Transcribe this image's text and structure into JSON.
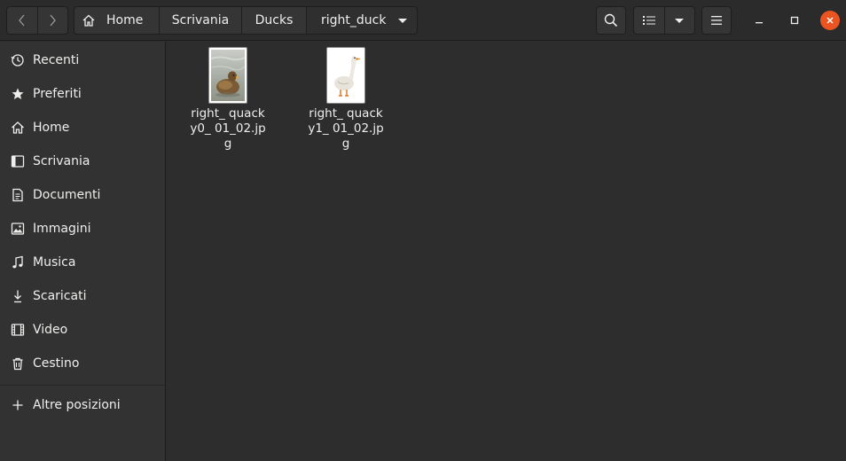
{
  "breadcrumb": [
    "Home",
    "Scrivania",
    "Ducks",
    "right_duck"
  ],
  "sidebar": {
    "items": [
      {
        "label": "Recenti",
        "icon": "clock-icon"
      },
      {
        "label": "Preferiti",
        "icon": "star-icon"
      },
      {
        "label": "Home",
        "icon": "home-icon"
      },
      {
        "label": "Scrivania",
        "icon": "desktop-icon"
      },
      {
        "label": "Documenti",
        "icon": "document-icon"
      },
      {
        "label": "Immagini",
        "icon": "image-icon"
      },
      {
        "label": "Musica",
        "icon": "music-icon"
      },
      {
        "label": "Scaricati",
        "icon": "download-icon"
      },
      {
        "label": "Video",
        "icon": "video-icon"
      },
      {
        "label": "Cestino",
        "icon": "trash-icon"
      }
    ],
    "other_locations": "Altre posizioni"
  },
  "files": [
    {
      "name": "right_ quacky0_ 01_02.jpg",
      "thumbnail": "brown-duck-on-water"
    },
    {
      "name": "right_ quacky1_ 01_02.jpg",
      "thumbnail": "white-goose"
    }
  ],
  "colors": {
    "accent": "#e95420",
    "background": "#2d2d2d",
    "sidebar": "#323232"
  }
}
